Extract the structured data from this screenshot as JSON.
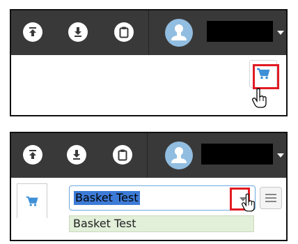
{
  "toolbar": {
    "icons": [
      "upload-icon",
      "download-icon",
      "clipboard-icon",
      "user-avatar-icon",
      "dropdown-caret-icon"
    ],
    "username": "",
    "bg_color": "#393939"
  },
  "panel1": {
    "cart_button_icon": "shopping-cart-icon",
    "cart_color": "#3d8fd6",
    "highlight_color": "#e21b23"
  },
  "panel2": {
    "cart_tab_icon": "shopping-cart-icon",
    "basket_select": {
      "value": "Basket Test",
      "arrow_icon": "chevron-down-icon"
    },
    "menu_icon": "hamburger-menu-icon",
    "options": [
      {
        "label": "Basket Test"
      }
    ],
    "highlight_color": "#e21b23"
  }
}
